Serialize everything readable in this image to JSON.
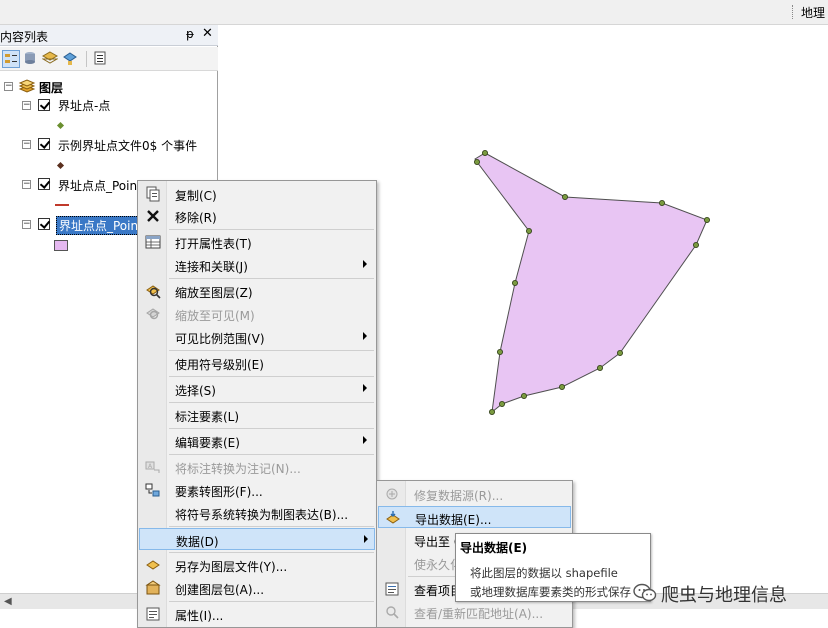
{
  "topbar": {
    "right_label": "地理"
  },
  "toc": {
    "title": "内容列表",
    "pin_glyph": "ᵽ",
    "close_glyph": "✕",
    "root": {
      "expander": "⊟",
      "label": "图层"
    },
    "layers": [
      {
        "label": "界址点-点",
        "symbol": "point",
        "color": "#6a8f2f"
      },
      {
        "label": "示例界址点文件0$ 个事件",
        "symbol": "point",
        "color": "#5a2f1e"
      },
      {
        "label": "界址点点_Point",
        "symbol": "line",
        "color": "#c0392b"
      },
      {
        "label": "界址点点_Poin",
        "symbol": "polygon",
        "color": "#e5b8f0",
        "selected": true
      }
    ]
  },
  "context_menu": {
    "items": [
      {
        "label": "复制(C)",
        "icon": "copy-icon",
        "disabled": false,
        "submenu": false
      },
      {
        "label": "移除(R)",
        "icon": "remove-x-icon",
        "disabled": false,
        "submenu": false
      },
      {
        "label": "打开属性表(T)",
        "icon": "table-icon",
        "disabled": false,
        "submenu": false
      },
      {
        "label": "连接和关联(J)",
        "icon": "",
        "disabled": false,
        "submenu": true
      },
      {
        "label": "缩放至图层(Z)",
        "icon": "zoom-layer-icon",
        "disabled": false,
        "submenu": false
      },
      {
        "label": "缩放至可见(M)",
        "icon": "zoom-visible-icon",
        "disabled": true,
        "submenu": false
      },
      {
        "label": "可见比例范围(V)",
        "icon": "",
        "disabled": false,
        "submenu": true
      },
      {
        "label": "使用符号级别(E)",
        "icon": "",
        "disabled": false,
        "submenu": false
      },
      {
        "label": "选择(S)",
        "icon": "",
        "disabled": false,
        "submenu": true
      },
      {
        "label": "标注要素(L)",
        "icon": "",
        "disabled": false,
        "submenu": false
      },
      {
        "label": "编辑要素(E)",
        "icon": "",
        "disabled": false,
        "submenu": true
      },
      {
        "label": "将标注转换为注记(N)...",
        "icon": "convert-labels-icon",
        "disabled": true,
        "submenu": false
      },
      {
        "label": "要素转图形(F)...",
        "icon": "features-to-graphics-icon",
        "disabled": false,
        "submenu": false
      },
      {
        "label": "将符号系统转换为制图表达(B)...",
        "icon": "",
        "disabled": false,
        "submenu": false
      },
      {
        "label": "数据(D)",
        "icon": "",
        "disabled": false,
        "submenu": true,
        "highlighted": true
      },
      {
        "label": "另存为图层文件(Y)...",
        "icon": "save-layer-icon",
        "disabled": false,
        "submenu": false
      },
      {
        "label": "创建图层包(A)...",
        "icon": "layer-package-icon",
        "disabled": false,
        "submenu": false
      },
      {
        "label": "属性(I)...",
        "icon": "properties-icon",
        "disabled": false,
        "submenu": false
      }
    ]
  },
  "data_submenu": {
    "items": [
      {
        "label": "修复数据源(R)...",
        "icon": "repair-source-icon",
        "disabled": true
      },
      {
        "label": "导出数据(E)...",
        "icon": "export-data-icon",
        "disabled": false,
        "highlighted": true
      },
      {
        "label": "导出至 C",
        "icon": "",
        "disabled": false
      },
      {
        "label": "使永久化",
        "icon": "",
        "disabled": true
      },
      {
        "label": "查看项目",
        "icon": "view-item-icon",
        "disabled": false
      },
      {
        "label": "查看/重新匹配地址(A)...",
        "icon": "rematch-icon",
        "disabled": true
      }
    ]
  },
  "tooltip": {
    "title": "导出数据(E)",
    "line1": "将此图层的数据以 shapefile",
    "line2": "或地理数据库要素类的形式保存"
  },
  "watermark": {
    "text": "爬虫与地理信息"
  },
  "map": {
    "polygon_fill": "#e8c5f3",
    "polygon_stroke": "#4f4f4f",
    "vertex_color": "#7a9a40"
  }
}
